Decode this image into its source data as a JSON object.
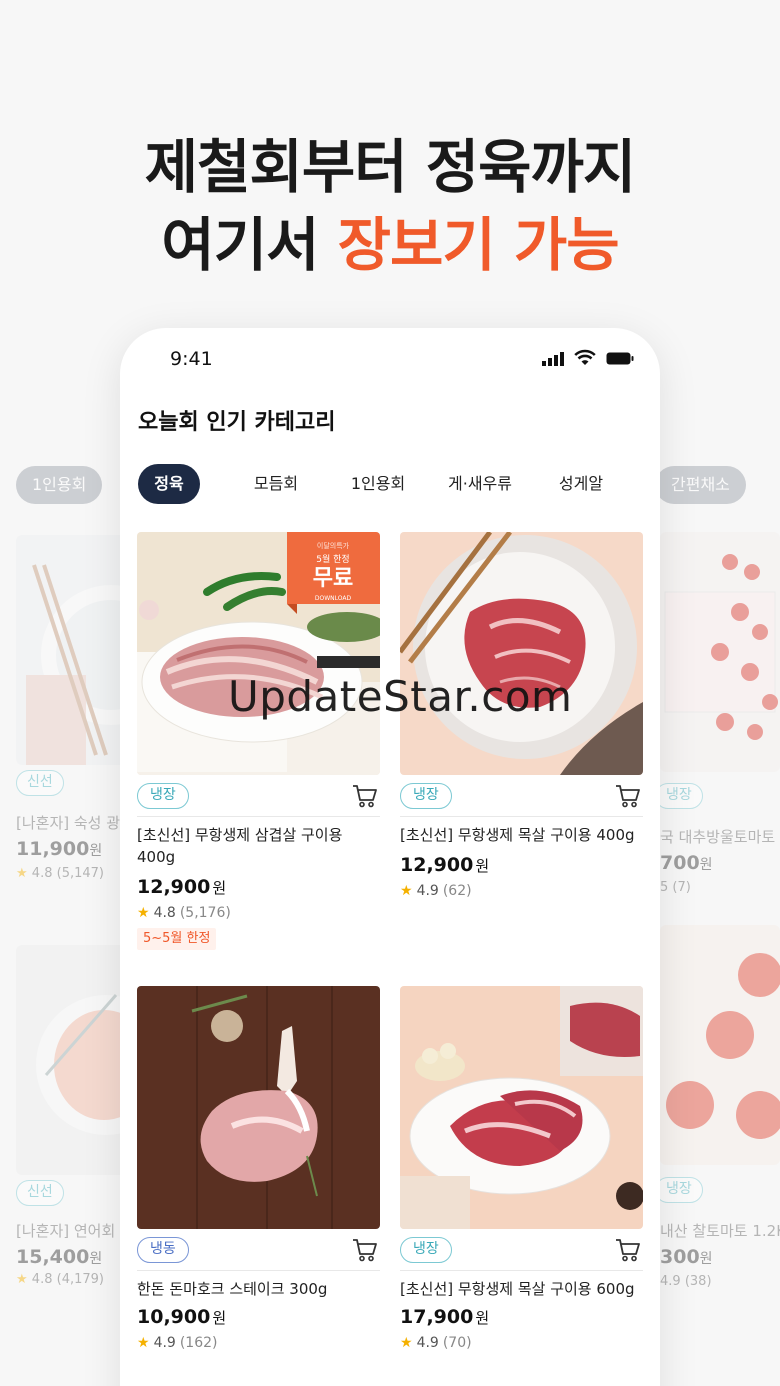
{
  "headline": {
    "line1": "제철회부터 정육까지",
    "line2_prefix": "여기서 ",
    "line2_accent": "장보기 가능"
  },
  "colors": {
    "accent": "#f05a2a",
    "tab_active": "#1d2a44",
    "badge_fridge": "#4ab3c1",
    "badge_frozen": "#4a6ec4",
    "star": "#f5b100"
  },
  "status_bar": {
    "time": "9:41"
  },
  "page_title": "오늘회 인기 카테고리",
  "tabs": [
    {
      "label": "정육",
      "active": true
    },
    {
      "label": "모듬회",
      "active": false
    },
    {
      "label": "1인용회",
      "active": false
    },
    {
      "label": "게·새우류",
      "active": false
    },
    {
      "label": "성게알",
      "active": false
    }
  ],
  "products": [
    {
      "badge": "냉장",
      "name": "[초신선] 무항생제 삼겹살 구이용 400g",
      "price": "12,900",
      "won": "원",
      "rating": "4.8",
      "count": "(5,176)",
      "promo": "5~5월 한정",
      "image_overlay": {
        "small": "5월 한정",
        "big": "무료",
        "sub": "DOWNLOAD"
      }
    },
    {
      "badge": "냉장",
      "name": "[초신선] 무항생제 목살 구이용 400g",
      "price": "12,900",
      "won": "원",
      "rating": "4.9",
      "count": "(62)"
    },
    {
      "badge": "냉동",
      "name": "한돈 돈마호크 스테이크 300g",
      "price": "10,900",
      "won": "원",
      "rating": "4.9",
      "count": "(162)"
    },
    {
      "badge": "냉장",
      "name": "[초신선] 무항생제 목살 구이용 600g",
      "price": "17,900",
      "won": "원",
      "rating": "4.9",
      "count": "(70)"
    }
  ],
  "background_left": {
    "chip": "1인용회",
    "items": [
      {
        "badge": "신선",
        "name": "[나혼자] 숙성 광어",
        "price": "11,900",
        "won": "원",
        "rating": "4.8",
        "count": "(5,147)"
      },
      {
        "badge": "신선",
        "name": "[나혼자] 연어회 (",
        "price": "15,400",
        "won": "원",
        "rating": "4.8",
        "count": "(4,179)"
      }
    ]
  },
  "background_right": {
    "chip": "간편채소",
    "items": [
      {
        "badge": "냉장",
        "name": "국 대추방울토마토",
        "price": "700",
        "won": "원",
        "rating": "5",
        "count": "(7)"
      },
      {
        "badge": "냉장",
        "name": "내산 찰토마토 1.2K",
        "price": "300",
        "won": "원",
        "rating": "4.9",
        "count": "(38)"
      }
    ]
  },
  "watermark": "UpdateStar.com"
}
